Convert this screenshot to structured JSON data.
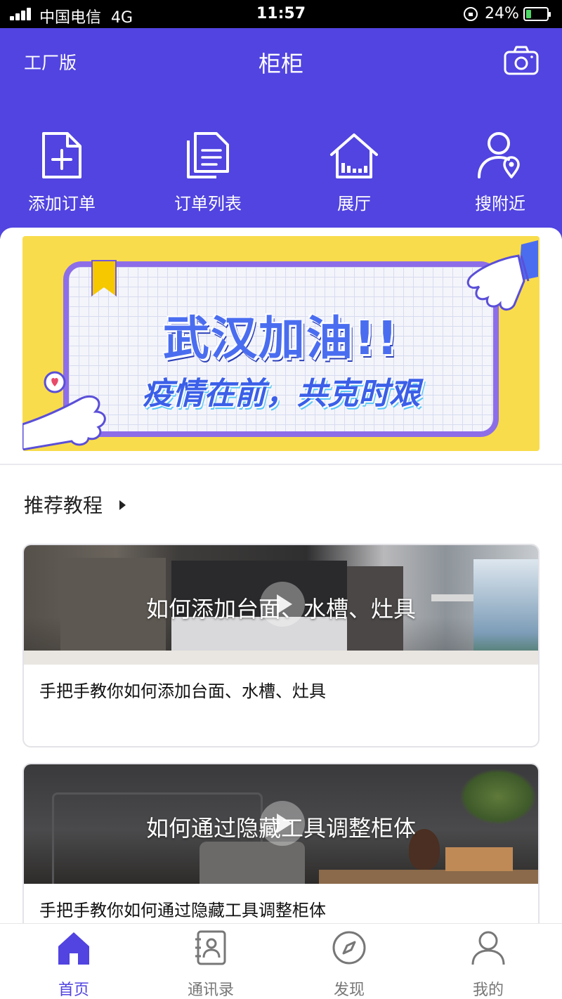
{
  "status_bar": {
    "carrier": "中国电信",
    "network": "4G",
    "time": "11:57",
    "battery_percent": "24%",
    "battery_level": 0.24
  },
  "header": {
    "edition": "工厂版",
    "title": "柜柜",
    "camera_icon": "camera-icon"
  },
  "quick_actions": [
    {
      "label": "添加订单",
      "icon": "add-document-icon"
    },
    {
      "label": "订单列表",
      "icon": "document-list-icon"
    },
    {
      "label": "展厅",
      "icon": "showroom-house-icon"
    },
    {
      "label": "搜附近",
      "icon": "nearby-person-icon"
    }
  ],
  "banner": {
    "headline": "武汉加油!!",
    "subline": "疫情在前，共克时艰"
  },
  "section": {
    "title": "推荐教程"
  },
  "tutorials": [
    {
      "overlay": "如何添加台面、水槽、灶具",
      "title": "手把手教你如何添加台面、水槽、灶具"
    },
    {
      "overlay": "如何通过隐藏工具调整柜体",
      "title": "手把手教你如何通过隐藏工具调整柜体"
    }
  ],
  "tabbar": [
    {
      "label": "首页",
      "icon": "home-icon",
      "active": true
    },
    {
      "label": "通讯录",
      "icon": "contacts-icon",
      "active": false
    },
    {
      "label": "发现",
      "icon": "compass-icon",
      "active": false
    },
    {
      "label": "我的",
      "icon": "person-icon",
      "active": false
    }
  ],
  "colors": {
    "brand": "#5144e0",
    "banner_bg": "#f9dc4c",
    "tab_inactive": "#777777"
  }
}
